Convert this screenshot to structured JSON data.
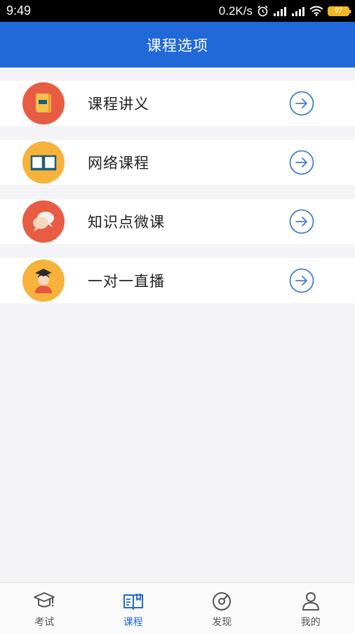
{
  "status_bar": {
    "time": "9:49",
    "network_speed": "0.2K/s",
    "battery_level": "97"
  },
  "header": {
    "title": "课程选项"
  },
  "menu": [
    {
      "label": "课程讲义",
      "icon": "book-icon",
      "color": "#e85c44"
    },
    {
      "label": "网络课程",
      "icon": "open-book-icon",
      "color": "#f6b23b"
    },
    {
      "label": "知识点微课",
      "icon": "chat-bubbles-icon",
      "color": "#e85c44"
    },
    {
      "label": "一对一直播",
      "icon": "graduate-avatar-icon",
      "color": "#f6b23b"
    }
  ],
  "tabs": [
    {
      "label": "考试",
      "icon": "graduation-cap-icon",
      "active": false
    },
    {
      "label": "课程",
      "icon": "course-book-icon",
      "active": true
    },
    {
      "label": "发现",
      "icon": "discover-icon",
      "active": false
    },
    {
      "label": "我的",
      "icon": "person-icon",
      "active": false
    }
  ],
  "colors": {
    "brand": "#2169d9",
    "arrow": "#3f7fd4"
  }
}
